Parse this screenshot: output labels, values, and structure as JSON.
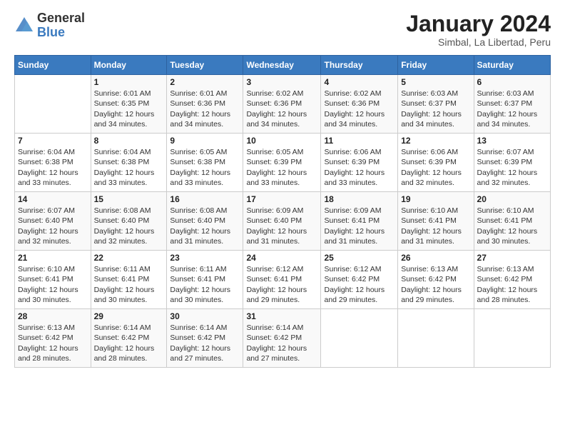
{
  "logo": {
    "general": "General",
    "blue": "Blue"
  },
  "title": "January 2024",
  "location": "Simbal, La Libertad, Peru",
  "days_of_week": [
    "Sunday",
    "Monday",
    "Tuesday",
    "Wednesday",
    "Thursday",
    "Friday",
    "Saturday"
  ],
  "weeks": [
    [
      {
        "day": "",
        "detail": ""
      },
      {
        "day": "1",
        "detail": "Sunrise: 6:01 AM\nSunset: 6:35 PM\nDaylight: 12 hours\nand 34 minutes."
      },
      {
        "day": "2",
        "detail": "Sunrise: 6:01 AM\nSunset: 6:36 PM\nDaylight: 12 hours\nand 34 minutes."
      },
      {
        "day": "3",
        "detail": "Sunrise: 6:02 AM\nSunset: 6:36 PM\nDaylight: 12 hours\nand 34 minutes."
      },
      {
        "day": "4",
        "detail": "Sunrise: 6:02 AM\nSunset: 6:36 PM\nDaylight: 12 hours\nand 34 minutes."
      },
      {
        "day": "5",
        "detail": "Sunrise: 6:03 AM\nSunset: 6:37 PM\nDaylight: 12 hours\nand 34 minutes."
      },
      {
        "day": "6",
        "detail": "Sunrise: 6:03 AM\nSunset: 6:37 PM\nDaylight: 12 hours\nand 34 minutes."
      }
    ],
    [
      {
        "day": "7",
        "detail": "Sunrise: 6:04 AM\nSunset: 6:38 PM\nDaylight: 12 hours\nand 33 minutes."
      },
      {
        "day": "8",
        "detail": "Sunrise: 6:04 AM\nSunset: 6:38 PM\nDaylight: 12 hours\nand 33 minutes."
      },
      {
        "day": "9",
        "detail": "Sunrise: 6:05 AM\nSunset: 6:38 PM\nDaylight: 12 hours\nand 33 minutes."
      },
      {
        "day": "10",
        "detail": "Sunrise: 6:05 AM\nSunset: 6:39 PM\nDaylight: 12 hours\nand 33 minutes."
      },
      {
        "day": "11",
        "detail": "Sunrise: 6:06 AM\nSunset: 6:39 PM\nDaylight: 12 hours\nand 33 minutes."
      },
      {
        "day": "12",
        "detail": "Sunrise: 6:06 AM\nSunset: 6:39 PM\nDaylight: 12 hours\nand 32 minutes."
      },
      {
        "day": "13",
        "detail": "Sunrise: 6:07 AM\nSunset: 6:39 PM\nDaylight: 12 hours\nand 32 minutes."
      }
    ],
    [
      {
        "day": "14",
        "detail": "Sunrise: 6:07 AM\nSunset: 6:40 PM\nDaylight: 12 hours\nand 32 minutes."
      },
      {
        "day": "15",
        "detail": "Sunrise: 6:08 AM\nSunset: 6:40 PM\nDaylight: 12 hours\nand 32 minutes."
      },
      {
        "day": "16",
        "detail": "Sunrise: 6:08 AM\nSunset: 6:40 PM\nDaylight: 12 hours\nand 31 minutes."
      },
      {
        "day": "17",
        "detail": "Sunrise: 6:09 AM\nSunset: 6:40 PM\nDaylight: 12 hours\nand 31 minutes."
      },
      {
        "day": "18",
        "detail": "Sunrise: 6:09 AM\nSunset: 6:41 PM\nDaylight: 12 hours\nand 31 minutes."
      },
      {
        "day": "19",
        "detail": "Sunrise: 6:10 AM\nSunset: 6:41 PM\nDaylight: 12 hours\nand 31 minutes."
      },
      {
        "day": "20",
        "detail": "Sunrise: 6:10 AM\nSunset: 6:41 PM\nDaylight: 12 hours\nand 30 minutes."
      }
    ],
    [
      {
        "day": "21",
        "detail": "Sunrise: 6:10 AM\nSunset: 6:41 PM\nDaylight: 12 hours\nand 30 minutes."
      },
      {
        "day": "22",
        "detail": "Sunrise: 6:11 AM\nSunset: 6:41 PM\nDaylight: 12 hours\nand 30 minutes."
      },
      {
        "day": "23",
        "detail": "Sunrise: 6:11 AM\nSunset: 6:41 PM\nDaylight: 12 hours\nand 30 minutes."
      },
      {
        "day": "24",
        "detail": "Sunrise: 6:12 AM\nSunset: 6:41 PM\nDaylight: 12 hours\nand 29 minutes."
      },
      {
        "day": "25",
        "detail": "Sunrise: 6:12 AM\nSunset: 6:42 PM\nDaylight: 12 hours\nand 29 minutes."
      },
      {
        "day": "26",
        "detail": "Sunrise: 6:13 AM\nSunset: 6:42 PM\nDaylight: 12 hours\nand 29 minutes."
      },
      {
        "day": "27",
        "detail": "Sunrise: 6:13 AM\nSunset: 6:42 PM\nDaylight: 12 hours\nand 28 minutes."
      }
    ],
    [
      {
        "day": "28",
        "detail": "Sunrise: 6:13 AM\nSunset: 6:42 PM\nDaylight: 12 hours\nand 28 minutes."
      },
      {
        "day": "29",
        "detail": "Sunrise: 6:14 AM\nSunset: 6:42 PM\nDaylight: 12 hours\nand 28 minutes."
      },
      {
        "day": "30",
        "detail": "Sunrise: 6:14 AM\nSunset: 6:42 PM\nDaylight: 12 hours\nand 27 minutes."
      },
      {
        "day": "31",
        "detail": "Sunrise: 6:14 AM\nSunset: 6:42 PM\nDaylight: 12 hours\nand 27 minutes."
      },
      {
        "day": "",
        "detail": ""
      },
      {
        "day": "",
        "detail": ""
      },
      {
        "day": "",
        "detail": ""
      }
    ]
  ]
}
